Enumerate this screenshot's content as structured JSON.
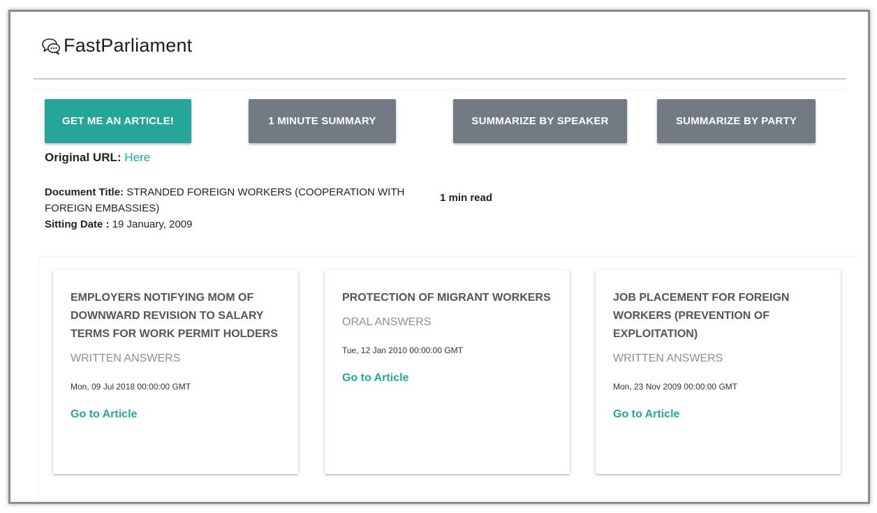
{
  "app": {
    "title": "FastParliament",
    "logo_icon": "chat-bubbles-icon"
  },
  "actions": {
    "get_article": "GET ME AN ARTICLE!",
    "one_minute_summary": "1 MINUTE SUMMARY",
    "summarize_by_speaker": "SUMMARIZE BY SPEAKER",
    "summarize_by_party": "SUMMARIZE BY PARTY"
  },
  "original_url": {
    "label": "Original URL:",
    "link_text": "Here"
  },
  "document": {
    "title_label": "Document Title:",
    "title": "STRANDED FOREIGN WORKERS (COOPERATION WITH FOREIGN EMBASSIES)",
    "date_label": "Sitting Date :",
    "date": "19 January, 2009",
    "read_time": "1 min read"
  },
  "related": [
    {
      "title": "EMPLOYERS NOTIFYING MOM OF DOWNWARD REVISION TO SALARY TERMS FOR WORK PERMIT HOLDERS",
      "type": "WRITTEN ANSWERS",
      "date": "Mon, 09 Jul 2018 00:00:00 GMT",
      "link": "Go to Article"
    },
    {
      "title": "PROTECTION OF MIGRANT WORKERS",
      "type": "ORAL ANSWERS",
      "date": "Tue, 12 Jan 2010 00:00:00 GMT",
      "link": "Go to Article"
    },
    {
      "title": "JOB PLACEMENT FOR FOREIGN WORKERS (PREVENTION OF EXPLOITATION)",
      "type": "WRITTEN ANSWERS",
      "date": "Mon, 23 Nov 2009 00:00:00 GMT",
      "link": "Go to Article"
    }
  ],
  "colors": {
    "accent": "#26a69a",
    "button_grey": "#727b84"
  }
}
